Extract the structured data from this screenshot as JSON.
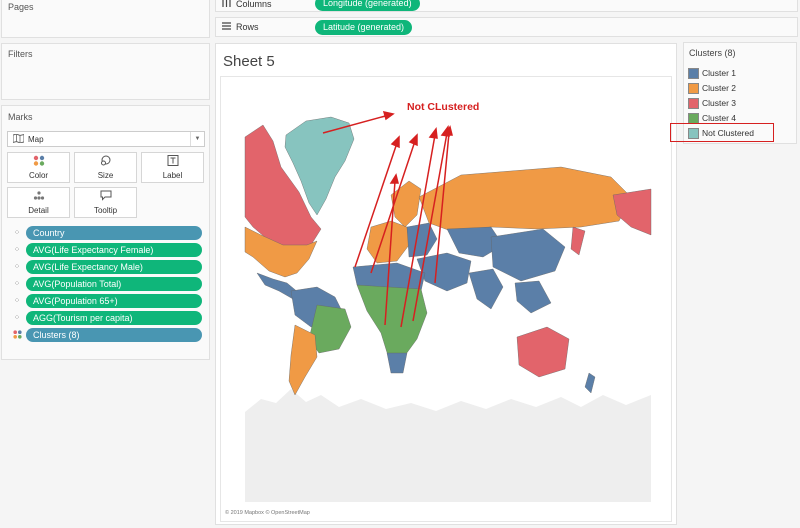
{
  "panels": {
    "pages_title": "Pages",
    "filters_title": "Filters",
    "marks_title": "Marks"
  },
  "shelves": {
    "columns_label": "Columns",
    "columns_pill": "Longitude (generated)",
    "rows_label": "Rows",
    "rows_pill": "Latitude (generated)"
  },
  "marks": {
    "mark_type": "Map",
    "buttons": [
      "Color",
      "Size",
      "Label",
      "Detail",
      "Tooltip"
    ],
    "fields": [
      {
        "label": "Country",
        "color": "blue",
        "icon": "detail-icon"
      },
      {
        "label": "AVG(Life Expectancy Female)",
        "color": "green",
        "icon": "detail-icon"
      },
      {
        "label": "AVG(Life Expectancy Male)",
        "color": "green",
        "icon": "detail-icon"
      },
      {
        "label": "AVG(Population Total)",
        "color": "green",
        "icon": "detail-icon"
      },
      {
        "label": "AVG(Population 65+)",
        "color": "green",
        "icon": "detail-icon"
      },
      {
        "label": "AGG(Tourism per capita)",
        "color": "green",
        "icon": "detail-icon"
      },
      {
        "label": "Clusters (8)",
        "color": "blue",
        "icon": "color-icon"
      }
    ]
  },
  "sheet": {
    "title": "Sheet 5",
    "attribution": "© 2019 Mapbox © OpenStreetMap"
  },
  "annotation": {
    "text": "Not CLustered",
    "color": "#d62020"
  },
  "legend": {
    "title": "Clusters (8)",
    "items": [
      {
        "label": "Cluster 1",
        "color": "#5b7fa8"
      },
      {
        "label": "Cluster 2",
        "color": "#f09a45"
      },
      {
        "label": "Cluster 3",
        "color": "#e2646b"
      },
      {
        "label": "Cluster 4",
        "color": "#6aaa5e"
      },
      {
        "label": "Not Clustered",
        "color": "#87c4bf"
      }
    ]
  },
  "colors": {
    "pill_green": "#0fb67a",
    "pill_blue": "#4996b2",
    "land_unclustered": "#eeeeee"
  }
}
